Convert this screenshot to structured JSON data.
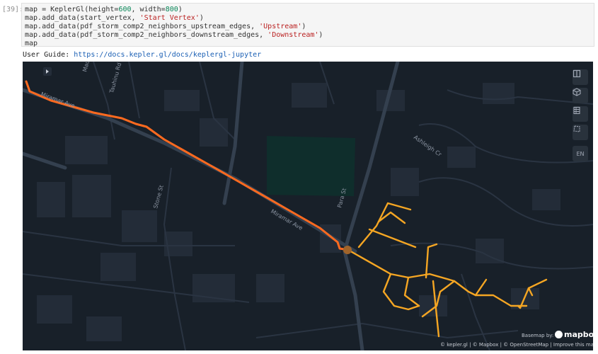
{
  "cell": {
    "prompt": "[39]:",
    "lines": [
      {
        "a": "map = KeplerGl(height=",
        "n1": "600",
        "b": ", width=",
        "n2": "800",
        "c": ")"
      },
      {
        "a": "map.add_data(start_vertex, ",
        "s": "'Start Vertex'",
        "c": ")"
      },
      {
        "a": "map.add_data(pdf_storm_comp2_neighbors_upstream_edges, ",
        "s": "'Upstream'",
        "c": ")"
      },
      {
        "a": "map.add_data(pdf_storm_comp2_neighbors_downstream_edges, ",
        "s": "'Downstream'",
        "c": ")"
      },
      {
        "a": "map"
      }
    ]
  },
  "output": {
    "guide_label": "User Guide: ",
    "guide_link": "https://docs.kepler.gl/docs/keplergl-jupyter"
  },
  "map": {
    "streets": {
      "miramar_1": "Miramar Ave",
      "miramar_2": "Miramar Ave",
      "tauhinu": "Tauhinu Rd",
      "stone": "Stone St",
      "para": "Para St",
      "ashleigh": "Ashleigh Cr",
      "mau": "Mau"
    },
    "toolbar": {
      "language": "EN"
    },
    "basemap_label": "Basemap by:",
    "mapbox_label": "mapbox",
    "attribution": "© kepler.gl | © Mapbox | © OpenStreetMap | Improve this map",
    "colors": {
      "background": "#182029",
      "upstream": "#ff6a1f",
      "downstream": "#f5a623",
      "start_vertex": "#a0642a"
    }
  }
}
